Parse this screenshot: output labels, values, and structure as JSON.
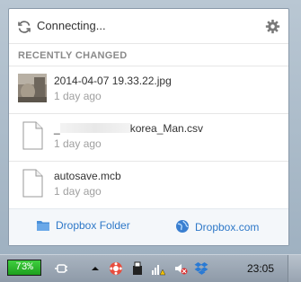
{
  "header": {
    "status_text": "Connecting...",
    "sync_icon": "sync-arrows-icon",
    "settings_icon": "gear-icon"
  },
  "recent": {
    "section_label": "RECENTLY CHANGED",
    "items": [
      {
        "name": "2014-04-07 19.33.22.jpg",
        "time": "1 day ago",
        "thumbnail": "photo-thumbnail"
      },
      {
        "name_prefix": "_",
        "name_suffix": "korea_Man.csv",
        "time": "1 day ago",
        "thumbnail": "document-icon"
      },
      {
        "name": "autosave.mcb",
        "time": "1 day ago",
        "thumbnail": "document-icon"
      }
    ]
  },
  "footer": {
    "folder_label": "Dropbox Folder",
    "web_label": "Dropbox.com"
  },
  "taskbar": {
    "battery_label": "73%",
    "clock": "23:05"
  },
  "colors": {
    "link": "#2e78c8",
    "battery": "#2fb82f"
  }
}
